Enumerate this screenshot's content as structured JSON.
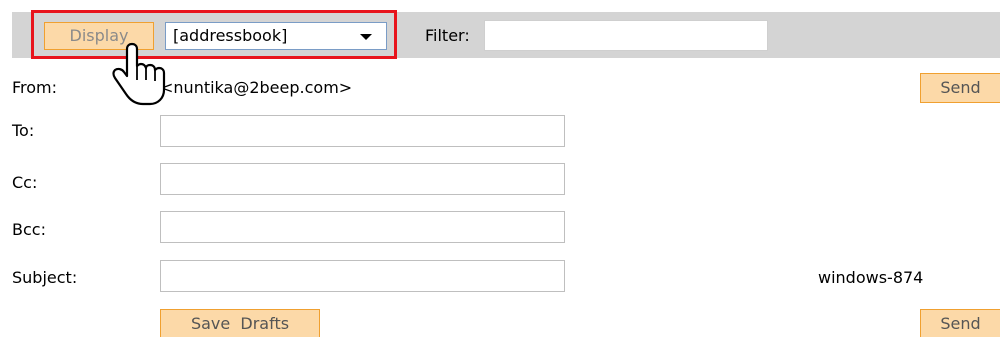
{
  "toolbar": {
    "display_label": "Display",
    "book_select_value": "[addressbook]",
    "filter_label": "Filter:",
    "filter_value": ""
  },
  "form": {
    "from_label": "From:",
    "from_value": "<nuntika@2beep.com>",
    "to_label": "To:",
    "to_value": "",
    "cc_label": "Cc:",
    "cc_value": "",
    "bcc_label": "Bcc:",
    "bcc_value": "",
    "subject_label": "Subject:",
    "subject_value": "",
    "charset": "windows-874"
  },
  "buttons": {
    "send_label": "Send",
    "save_drafts_label": "Save  Drafts"
  },
  "icons": {
    "cursor": "hand-pointer-icon"
  },
  "colors": {
    "highlight": "#e8141c",
    "button_bg": "#fcd9a8",
    "button_border": "#f0a030",
    "toolbar_bg": "#d4d4d4"
  }
}
